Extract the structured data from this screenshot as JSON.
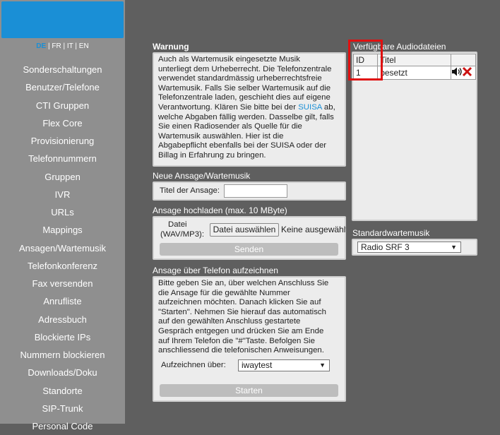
{
  "languages": {
    "de": "DE",
    "fr": "FR",
    "it": "IT",
    "en": "EN",
    "sep": "|"
  },
  "nav": [
    "Sonderschaltungen",
    "Benutzer/Telefone",
    "CTI Gruppen",
    "Flex Core",
    "Provisionierung",
    "Telefonnummern",
    "Gruppen",
    "IVR",
    "URLs",
    "Mappings",
    "Ansagen/Wartemusik",
    "Telefonkonferenz",
    "Fax versenden",
    "Anrufliste",
    "Adressbuch",
    "Blockierte IPs",
    "Nummern blockieren",
    "Downloads/Doku",
    "Standorte",
    "SIP-Trunk",
    "Personal Code"
  ],
  "warning": {
    "title": "Warnung",
    "lines": [
      "Auch als Wartemusik eingesetzte Musik",
      "unterliegt dem Urheberrecht. Die Telefonzentrale",
      "verwendet standardmässig urheberrechtsfreie",
      "Wartemusik. Falls Sie selber Wartemusik auf die",
      "Telefonzentrale laden, geschieht dies auf eigene",
      "Verantwortung. Klären Sie bitte bei der",
      "welche Abgaben fällig werden. Dasselbe gilt, falls",
      "Sie einen Radiosender als Quelle für die",
      "Wartemusik auswählen. Hier ist die",
      "Abgabepflicht ebenfalls bei der SUISA oder der",
      "Billag in Erfahrung zu bringen."
    ],
    "link": "SUISA",
    "link_after": " ab,"
  },
  "new_announcement": {
    "title": "Neue Ansage/Wartemusik",
    "label": "Titel der Ansage:",
    "value": ""
  },
  "upload": {
    "title": "Ansage hochladen (max. 10 MByte)",
    "file_label_1": "Datei",
    "file_label_2": "(WAV/MP3):",
    "choose_button": "Datei auswählen",
    "no_file": "Keine ausgewählt",
    "send_button": "Senden"
  },
  "record": {
    "title": "Ansage über Telefon aufzeichnen",
    "lines": [
      "Bitte geben Sie an, über welchen Anschluss Sie",
      "die Ansage für die gewählte Nummer",
      "aufzeichnen möchten. Danach klicken Sie auf",
      "\"Starten\". Nehmen Sie hierauf das automatisch",
      "auf den gewählten Anschluss gestartete",
      "Gespräch entgegen und drücken Sie am Ende",
      "auf Ihrem Telefon die \"#\"Taste. Befolgen Sie",
      "anschliessend die telefonischen Anweisungen."
    ],
    "select_label": "Aufzeichnen über:",
    "select_value": "iwaytest",
    "start_button": "Starten"
  },
  "audio_files": {
    "title": "Verfügbare Audiodateien",
    "headers": [
      "ID",
      "Titel"
    ],
    "rows": [
      {
        "id": "1",
        "title": "besetzt"
      }
    ]
  },
  "default_music": {
    "title": "Standardwartemusik",
    "value": "Radio SRF 3"
  },
  "colors": {
    "brand": "#1a8fd6",
    "highlight": "#e01010",
    "delete": "#cc1111"
  }
}
